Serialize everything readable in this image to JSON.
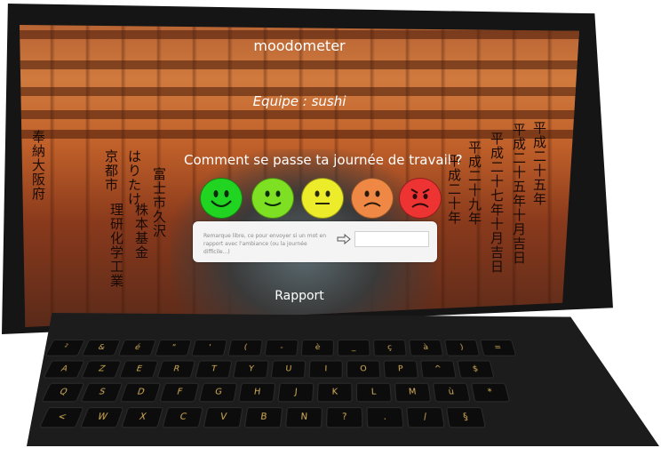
{
  "app": {
    "title": "moodometer",
    "team_label": "Equipe : sushi",
    "question": "Comment se passe ta journée de travail ?",
    "report_link": "Rapport"
  },
  "moods": [
    {
      "id": "very-happy",
      "color": "#22d422",
      "icon": "big-smile-face-icon"
    },
    {
      "id": "happy",
      "color": "#7de022",
      "icon": "smile-face-icon"
    },
    {
      "id": "neutral",
      "color": "#ecec2a",
      "icon": "neutral-face-icon"
    },
    {
      "id": "sad",
      "color": "#ee8844",
      "icon": "sad-face-icon"
    },
    {
      "id": "angry",
      "color": "#ee3333",
      "icon": "angry-face-icon"
    }
  ],
  "comment": {
    "text": "Remarque libre, ce pour envoyer si un mot en rapport avec l'ambiance (ou la journée difficile...)",
    "placeholder": ""
  },
  "keyboard": {
    "rows": [
      [
        "²",
        "&",
        "é",
        "\"",
        "'",
        "(",
        "-",
        "è",
        "_",
        "ç",
        "à",
        ")",
        "="
      ],
      [
        "A",
        "Z",
        "E",
        "R",
        "T",
        "Y",
        "U",
        "I",
        "O",
        "P",
        "^",
        "$"
      ],
      [
        "Q",
        "S",
        "D",
        "F",
        "G",
        "H",
        "J",
        "K",
        "L",
        "M",
        "ù",
        "*"
      ],
      [
        "<",
        "W",
        "X",
        "C",
        "V",
        "B",
        "N",
        "?",
        ".",
        "/",
        "§"
      ]
    ]
  }
}
